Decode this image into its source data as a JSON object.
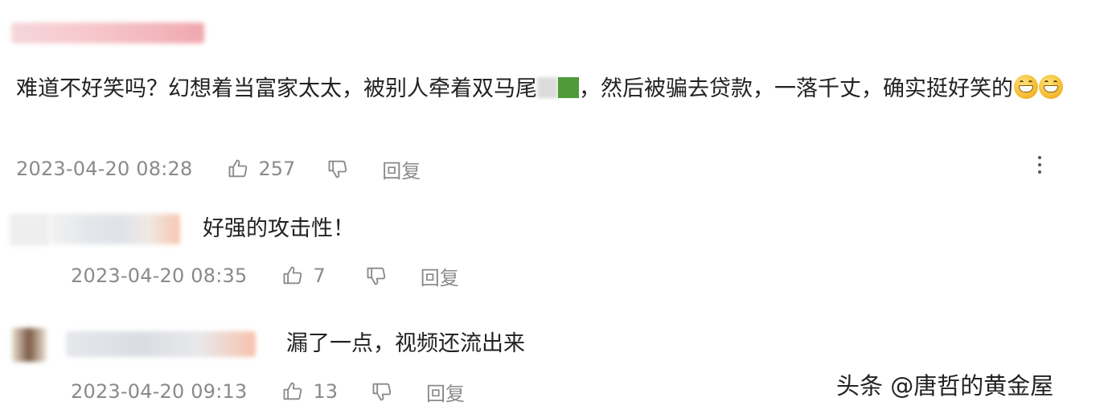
{
  "comments": [
    {
      "text_before": "难道不好笑吗？幻想着当富家太太，被别人牵着双马尾",
      "text_after": "，然后被骗去贷款，一落千丈，确实挺好笑的",
      "emoji": [
        "grin-emoji",
        "grin-emoji"
      ],
      "time": "2023-04-20 08:28",
      "likes": "257",
      "reply_label": "回复"
    },
    {
      "text": "好强的攻击性！",
      "time": "2023-04-20 08:35",
      "likes": "7",
      "reply_label": "回复"
    },
    {
      "text": "漏了一点，视频还流出来",
      "time": "2023-04-20 09:13",
      "likes": "13",
      "reply_label": "回复"
    }
  ],
  "icons": {
    "like": "thumbs-up-icon",
    "dislike": "thumbs-down-icon",
    "more": "more-vertical-icon"
  },
  "watermark": "头条 @唐哲的黄金屋",
  "colors": {
    "text": "#222222",
    "meta": "#8a8a8a"
  }
}
